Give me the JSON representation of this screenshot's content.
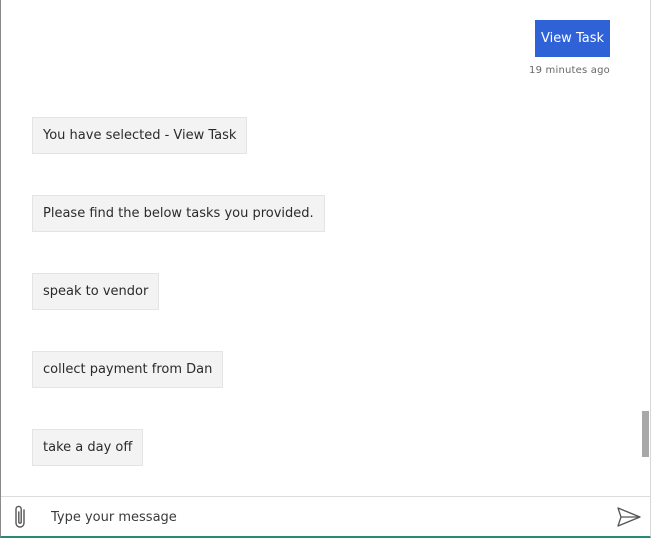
{
  "conversation": {
    "user_message": "View Task",
    "user_timestamp": "19 minutes ago",
    "bot_messages": [
      "You have selected - View Task",
      "Please find the below tasks you provided.",
      "speak to vendor",
      "collect payment from Dan",
      "take a day off"
    ]
  },
  "composer": {
    "placeholder": "Type your message",
    "attach_icon": "paperclip-icon",
    "send_icon": "send-icon"
  },
  "colors": {
    "user_bubble": "#2f62d7",
    "bot_bubble": "#f3f3f3",
    "bottom_accent": "#2a8a7a"
  }
}
